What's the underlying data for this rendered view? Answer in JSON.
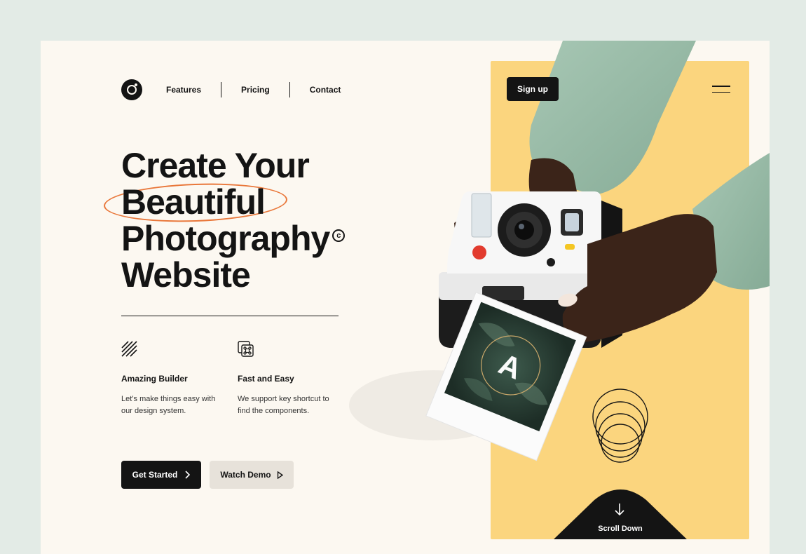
{
  "nav": {
    "links": [
      "Features",
      "Pricing",
      "Contact"
    ],
    "signup_label": "Sign up"
  },
  "hero": {
    "headline_lines": [
      "Create Your",
      "Beautiful",
      "Photography",
      "Website"
    ],
    "copyright_symbol": "c"
  },
  "features": [
    {
      "icon": "diagonal-lines-icon",
      "title": "Amazing Builder",
      "text_lines": [
        "Let’s make things easy with",
        "our design system."
      ]
    },
    {
      "icon": "command-key-icon",
      "title": "Fast and Easy",
      "text_lines": [
        "We support key shortcut to",
        "find the components."
      ]
    }
  ],
  "actions": {
    "primary_label": "Get Started",
    "secondary_label": "Watch Demo"
  },
  "scroll": {
    "label": "Scroll Down"
  },
  "photo": {
    "letter": "A"
  },
  "colors": {
    "background": "#e3ebe6",
    "page": "#fcf8f1",
    "accent_yellow": "#fbd57e",
    "accent_orange": "#e9773a",
    "ink": "#141414",
    "sleeve": "#9dbfac"
  }
}
